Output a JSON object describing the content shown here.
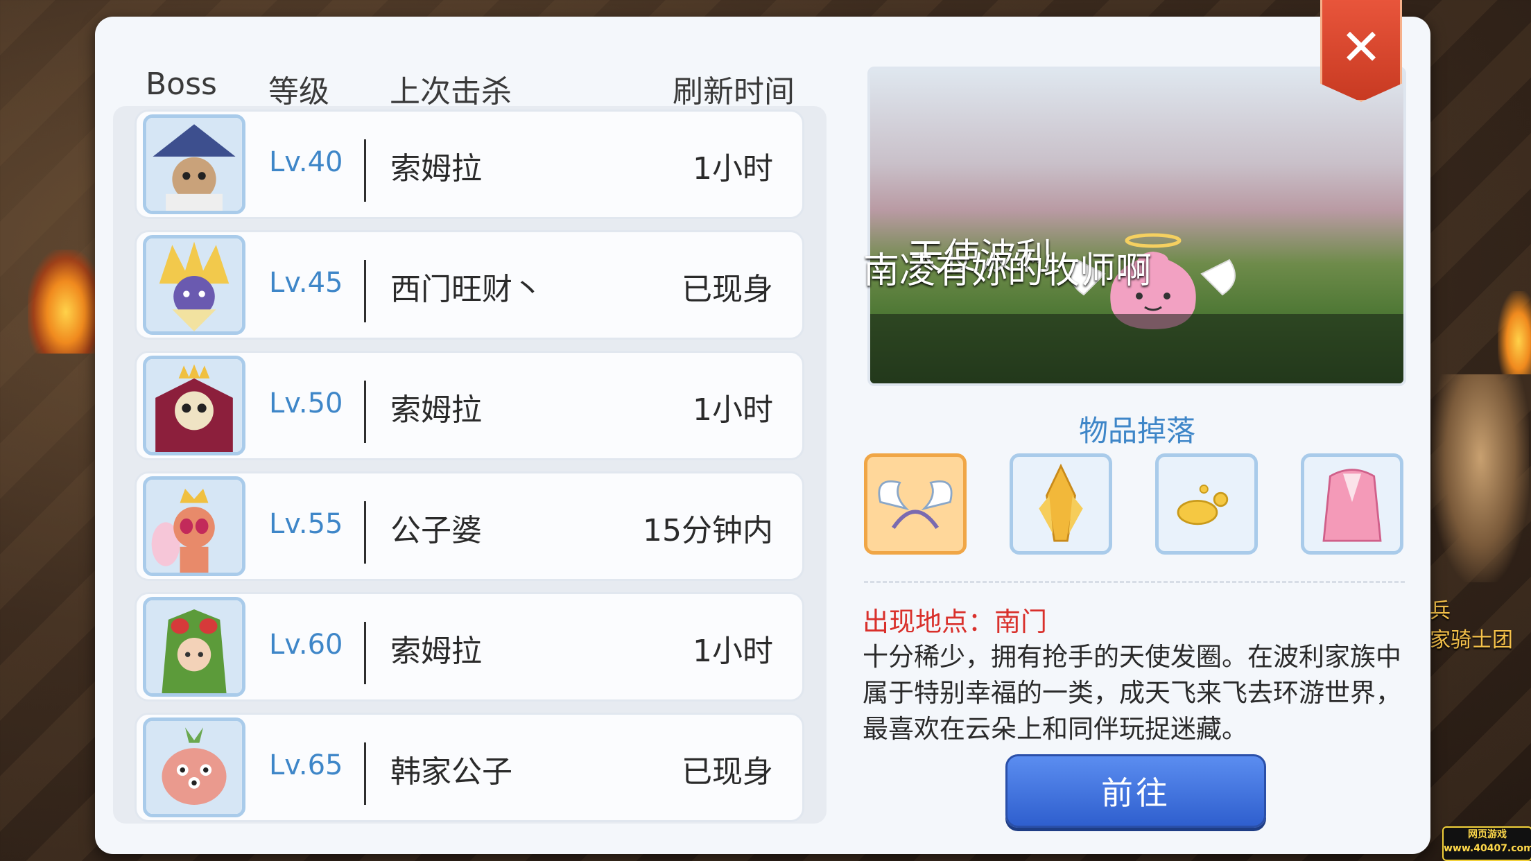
{
  "headers": {
    "boss": "Boss",
    "level": "等级",
    "last_kill": "上次击杀",
    "refresh": "刷新时间"
  },
  "bosses": [
    {
      "level": "Lv.40",
      "last_kill": "索姆拉",
      "refresh": "1小时",
      "avatar_icon": "pirate-boss-icon"
    },
    {
      "level": "Lv.45",
      "last_kill": "西门旺财丶",
      "refresh": "已现身",
      "avatar_icon": "golden-hair-boss-icon"
    },
    {
      "level": "Lv.50",
      "last_kill": "索姆拉",
      "refresh": "1小时",
      "avatar_icon": "skull-king-boss-icon"
    },
    {
      "level": "Lv.55",
      "last_kill": "公子婆",
      "refresh": "15分钟内",
      "avatar_icon": "queen-bee-boss-icon"
    },
    {
      "level": "Lv.60",
      "last_kill": "索姆拉",
      "refresh": "1小时",
      "avatar_icon": "mantis-girl-boss-icon"
    },
    {
      "level": "Lv.65",
      "last_kill": "韩家公子",
      "refresh": "已现身",
      "avatar_icon": "eyeball-plant-boss-icon"
    }
  ],
  "preview": {
    "name": "天使波利",
    "subtitle": "南凌有妳的牧师啊",
    "image_icon": "angel-poring-icon"
  },
  "drops": {
    "title": "物品掉落",
    "items": [
      "angel-wing-hairband-icon",
      "gold-crystal-icon",
      "golden-jelly-icon",
      "pink-fluffy-coat-icon"
    ]
  },
  "location": "出现地点：南门",
  "description": "十分稀少，拥有抢手的天使发圈。在波利家族中属于特别幸福的一类，成天飞来飞去环游世界，最喜欢在云朵上和同伴玩捉迷藏。",
  "go_button": "前往",
  "close_icon": "close-icon",
  "background": {
    "npc_label_1": "兵",
    "npc_label_2": "家骑士团",
    "watermark_1": "网页游戏",
    "watermark_2": "www.40407.com"
  },
  "colors": {
    "level_blue": "#3e86c8",
    "location_red": "#d9302b",
    "close_red": "#d8472e",
    "button_blue": "#3f70dc"
  }
}
